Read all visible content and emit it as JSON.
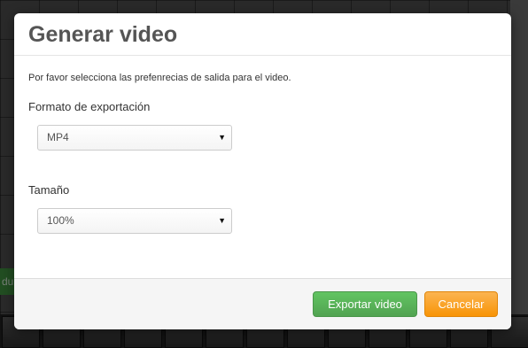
{
  "background": {
    "side_text": "du"
  },
  "dialog": {
    "title": "Generar video",
    "intro": "Por favor selecciona las prefenrecias de salida para el video.",
    "format": {
      "label": "Formato de exportación",
      "value": "MP4"
    },
    "size": {
      "label": "Tamaño",
      "value": "100%"
    },
    "buttons": {
      "export": "Exportar video",
      "cancel": "Cancelar"
    },
    "colors": {
      "export": "#5bb75b",
      "cancel": "#faa732"
    }
  },
  "icons": {
    "dropdown": "▼"
  }
}
